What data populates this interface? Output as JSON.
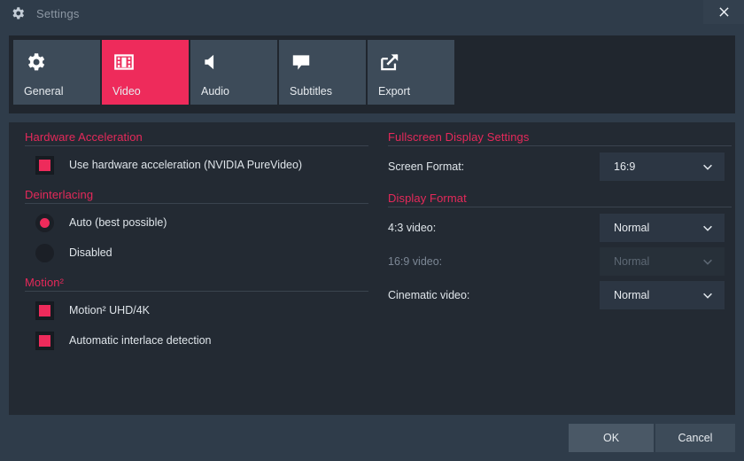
{
  "window": {
    "icon": "gear-icon",
    "title": "Settings",
    "close_label": "×"
  },
  "tabs": [
    {
      "id": "general",
      "label": "General",
      "icon": "gear-icon",
      "active": false
    },
    {
      "id": "video",
      "label": "Video",
      "icon": "filmstrip-icon",
      "active": true
    },
    {
      "id": "audio",
      "label": "Audio",
      "icon": "speaker-icon",
      "active": false
    },
    {
      "id": "subtitles",
      "label": "Subtitles",
      "icon": "speech-bubble-icon",
      "active": false
    },
    {
      "id": "export",
      "label": "Export",
      "icon": "export-arrow-icon",
      "active": false
    }
  ],
  "left": {
    "hardware_acceleration": {
      "title": "Hardware Acceleration",
      "checkbox_label": "Use hardware acceleration (NVIDIA PureVideo)",
      "checked": true
    },
    "deinterlacing": {
      "title": "Deinterlacing",
      "options": [
        {
          "label": "Auto (best possible)",
          "selected": true
        },
        {
          "label": "Disabled",
          "selected": false
        }
      ]
    },
    "motion": {
      "title": "Motion²",
      "checkboxes": [
        {
          "label": "Motion²  UHD/4K",
          "checked": true
        },
        {
          "label": "Automatic interlace detection",
          "checked": true
        }
      ]
    }
  },
  "right": {
    "fullscreen_display": {
      "title": "Fullscreen Display Settings",
      "rows": [
        {
          "label": "Screen Format:",
          "value": "16:9",
          "disabled": false
        }
      ]
    },
    "display_format": {
      "title": "Display Format",
      "rows": [
        {
          "label": "4:3 video:",
          "value": "Normal",
          "disabled": false
        },
        {
          "label": "16:9 video:",
          "value": "Normal",
          "disabled": true
        },
        {
          "label": "Cinematic video:",
          "value": "Normal",
          "disabled": false
        }
      ]
    }
  },
  "footer": {
    "ok_label": "OK",
    "cancel_label": "Cancel"
  },
  "colors": {
    "accent": "#ee2b5b",
    "section_heading": "#e5295a",
    "window_bg": "#2f3c4a",
    "content_bg": "#232a33",
    "tabstrip_bg": "#20262e",
    "tab_bg": "#3d4b59",
    "text": "#dfe5ea",
    "text_disabled": "#7c8795"
  }
}
